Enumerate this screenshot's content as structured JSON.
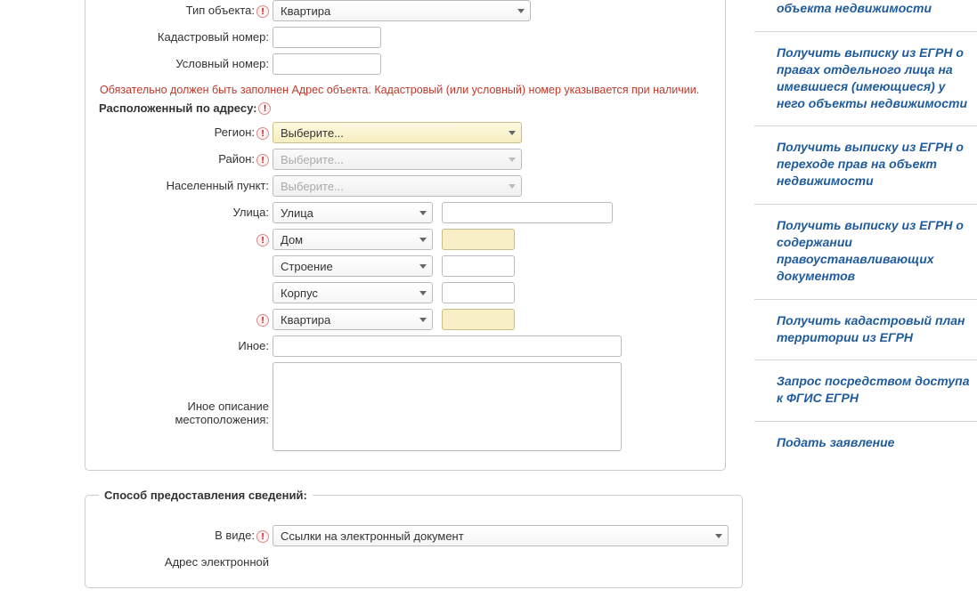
{
  "form": {
    "object_type": {
      "label": "Тип объекта:",
      "value": "Квартира"
    },
    "cad_number": {
      "label": "Кадастровый номер:",
      "value": ""
    },
    "cond_number": {
      "label": "Условный номер:",
      "value": ""
    },
    "warning": "Обязательно должен быть заполнен Адрес объекта. Кадастровый (или условный) номер указывается при наличии.",
    "address_section": "Расположенный по адресу:",
    "region": {
      "label": "Регион:",
      "value": "Выберите..."
    },
    "district": {
      "label": "Район:",
      "value": "Выберите..."
    },
    "locality": {
      "label": "Населенный пункт:",
      "value": "Выберите..."
    },
    "street": {
      "label": "Улица:",
      "value": "Улица",
      "text": ""
    },
    "house": {
      "value": "Дом",
      "text": ""
    },
    "building": {
      "value": "Строение",
      "text": ""
    },
    "korpus": {
      "value": "Корпус",
      "text": ""
    },
    "flat": {
      "value": "Квартира",
      "text": ""
    },
    "other": {
      "label": "Иное:",
      "value": ""
    },
    "other_desc": {
      "label": "Иное описание местоположения:",
      "value": ""
    }
  },
  "delivery": {
    "legend": "Способ предоставления сведений:",
    "format": {
      "label": "В виде:",
      "value": "Ссылки на электронный документ"
    },
    "email": {
      "label": "Адрес электронной"
    }
  },
  "sidebar": {
    "items": [
      "объекта недвижимости",
      "Получить выписку из ЕГРН о правах отдельного лица на имевшиеся (имеющиеся) у него объекты недвижимости",
      "Получить выписку из ЕГРН о переходе прав на объект недвижимости",
      "Получить выписку из ЕГРН о содержании правоустанавливающих документов",
      "Получить кадастровый план территории из ЕГРН",
      "Запрос посредством доступа к ФГИС ЕГРН",
      "Подать заявление"
    ]
  }
}
